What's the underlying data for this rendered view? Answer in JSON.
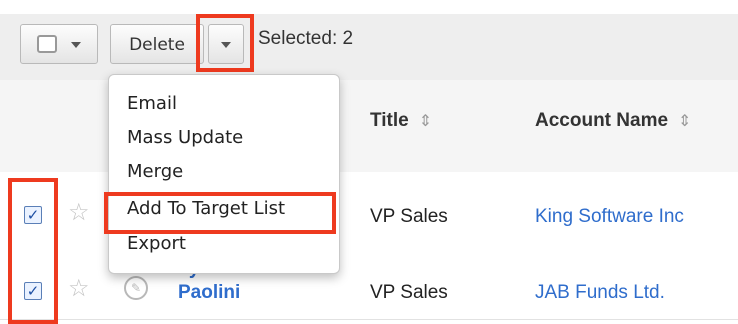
{
  "toolbar": {
    "delete_label": "Delete",
    "selected_text": "Selected: 2"
  },
  "columns": [
    {
      "label": "Title",
      "sort_icon": "sort-icon"
    },
    {
      "label": "Account Name",
      "sort_icon": "sort-icon"
    }
  ],
  "menu": {
    "items": [
      "Email",
      "Mass Update",
      "Merge",
      "Add To Target List",
      "Export"
    ]
  },
  "rows": [
    {
      "name": "",
      "title": "VP Sales",
      "account": "King Software Inc",
      "checked": true
    },
    {
      "name_line1": "Lynwood",
      "name_line2": "Paolini",
      "title": "VP Sales",
      "account": "JAB Funds Ltd.",
      "checked": true
    }
  ],
  "colors": {
    "highlight": "#ee3a1f",
    "link": "#2f6dcc"
  }
}
